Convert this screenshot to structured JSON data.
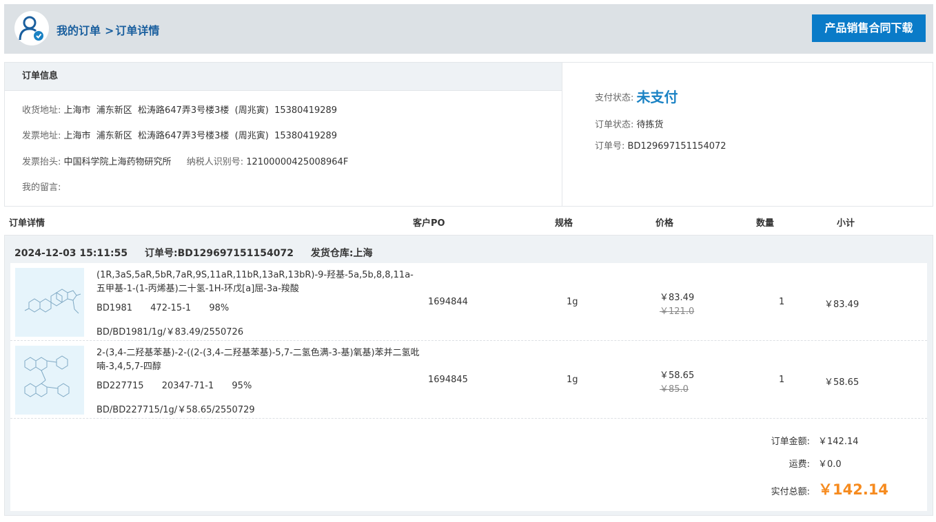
{
  "header": {
    "breadcrumb_root": "我的订单",
    "breadcrumb_sep": ">",
    "breadcrumb_current": "订单详情",
    "download_button": "产品销售合同下载"
  },
  "order_info": {
    "title": "订单信息",
    "shipping_label": "收货地址:",
    "shipping_value": "上海市  浦东新区  松涛路647弄3号楼3楼  (周兆寅)  15380419289",
    "invoice_addr_label": "发票地址:",
    "invoice_addr_value": "上海市  浦东新区  松涛路647弄3号楼3楼  (周兆寅)  15380419289",
    "invoice_title_label": "发票抬头:",
    "invoice_title_value": "中国科学院上海药物研究所",
    "tax_id_label": "纳税人识别号:",
    "tax_id_value": "12100000425008964F",
    "message_label": "我的留言:",
    "message_value": ""
  },
  "status": {
    "pay_label": "支付状态:",
    "pay_value": "未支付",
    "order_status_label": "订单状态:",
    "order_status_value": "待拣货",
    "order_no_label": "订单号:",
    "order_no_value": "BD129697151154072"
  },
  "table": {
    "col_detail": "订单详情",
    "col_po": "客户PO",
    "col_spec": "规格",
    "col_price": "价格",
    "col_qty": "数量",
    "col_subtotal": "小计"
  },
  "order": {
    "datetime": "2024-12-03 15:11:55",
    "order_no_label": "订单号:",
    "order_no": "BD129697151154072",
    "warehouse_label": "发货仓库:",
    "warehouse": "上海",
    "items": [
      {
        "name": "(1R,3aS,5aR,5bR,7aR,9S,11aR,11bR,13aR,13bR)-9-羟基-5a,5b,8,8,11a-五甲基-1-(1-丙烯基)二十氢-1H-环戊[a]屈-3a-羧酸",
        "code": "BD1981",
        "cas": "472-15-1",
        "purity": "98%",
        "sku": "BD/BD1981/1g/￥83.49/2550726",
        "po": "1694844",
        "spec": "1g",
        "price": "￥83.49",
        "original_price": "￥121.0",
        "qty": "1",
        "subtotal": "￥83.49"
      },
      {
        "name": "2-(3,4-二羟基苯基)-2-((2-(3,4-二羟基苯基)-5,7-二氢色满-3-基)氧基)苯并二氢吡喃-3,4,5,7-四醇",
        "code": "BD227715",
        "cas": "20347-71-1",
        "purity": "95%",
        "sku": "BD/BD227715/1g/￥58.65/2550729",
        "po": "1694845",
        "spec": "1g",
        "price": "￥58.65",
        "original_price": "￥85.0",
        "qty": "1",
        "subtotal": "￥58.65"
      }
    ]
  },
  "summary": {
    "amount_label": "订单金额:",
    "amount": "￥142.14",
    "shipping_label": "运费:",
    "shipping": "￥0.0",
    "total_label": "实付总额:",
    "total": "￥142.14"
  },
  "colors": {
    "accent": "#0a7bc8",
    "link": "#1a5f9e",
    "total": "#f68b1f",
    "header_bg": "#dce1e5"
  }
}
